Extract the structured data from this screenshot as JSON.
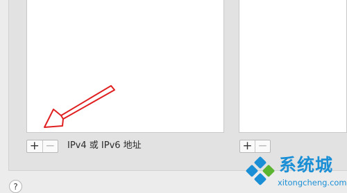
{
  "left_panel": {
    "add_symbol": "+",
    "remove_symbol": "−",
    "field_label": "IPv4 或 IPv6 地址"
  },
  "right_panel": {
    "add_symbol": "+",
    "remove_symbol": "−"
  },
  "help": {
    "symbol": "?"
  },
  "watermark": {
    "name": "系统城",
    "url": "xitongcheng.com"
  },
  "colors": {
    "annotation_arrow": "#e02020",
    "watermark_blue": "#1a8fd6",
    "watermark_green": "#5cb531"
  },
  "icons": {
    "annotation": "red-arrow-icon",
    "watermark_logo": "pinwheel-logo-icon"
  }
}
